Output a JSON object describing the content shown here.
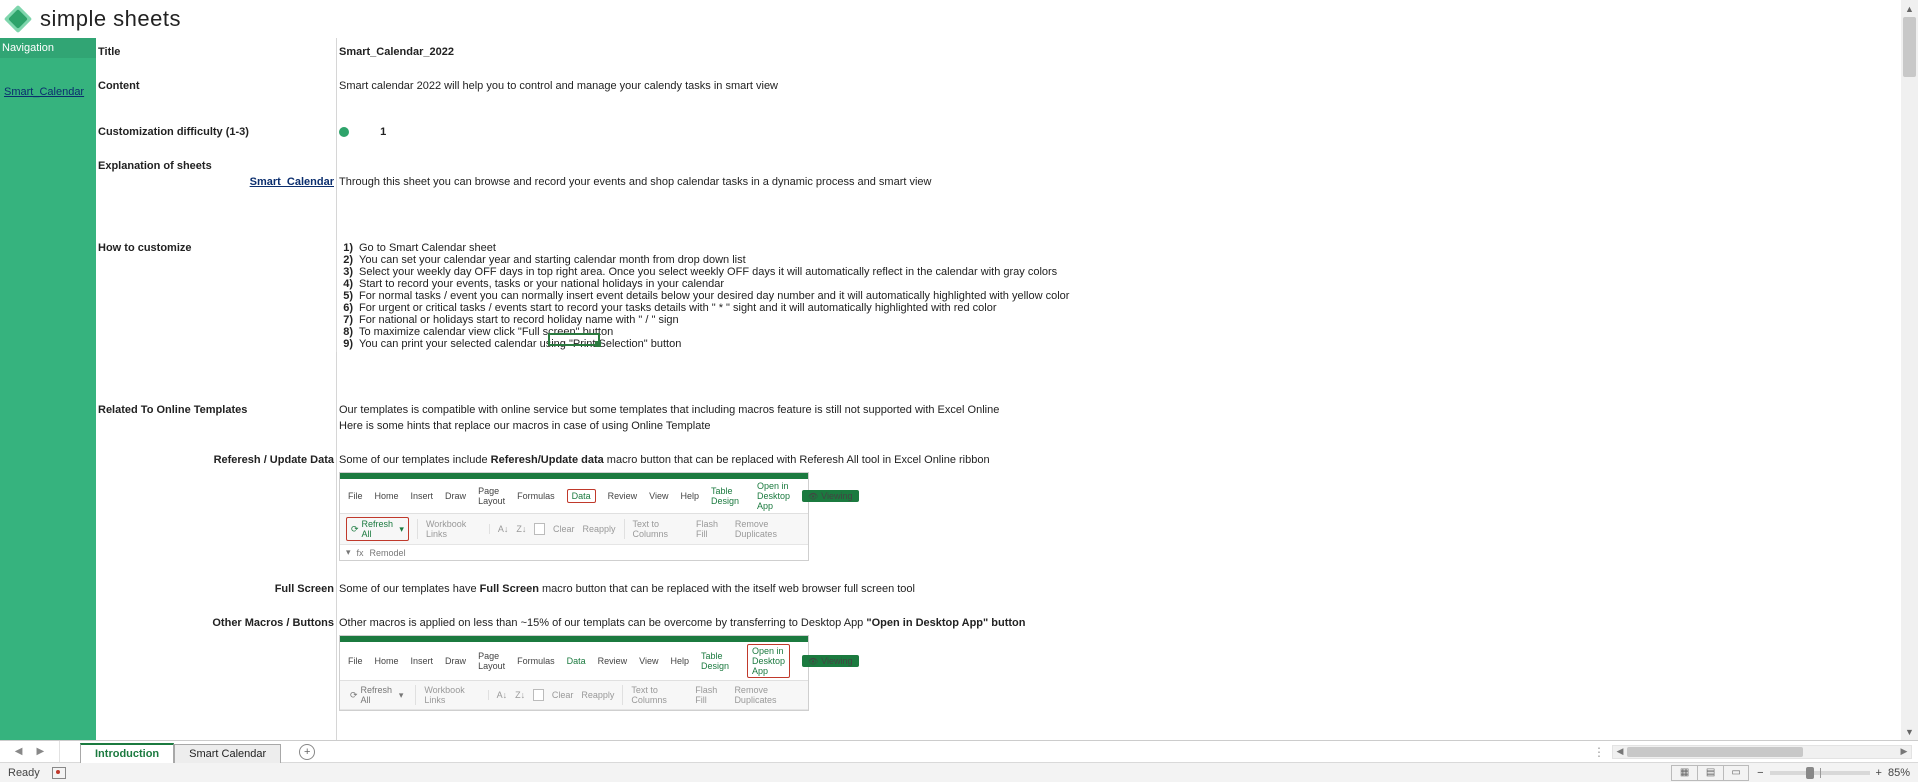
{
  "brand": {
    "name": "simple sheets"
  },
  "sidebar": {
    "nav_title": "Navigation",
    "link": "Smart_Calendar"
  },
  "labels": {
    "title": "Title",
    "content": "Content",
    "difficulty": "Customization difficulty (1-3)",
    "explanation": "Explanation of sheets",
    "howto": "How to customize",
    "related": "Related To Online Templates",
    "refresh": "Referesh / Update Data",
    "fullscreen": "Full Screen",
    "other": "Other Macros / Buttons"
  },
  "values": {
    "title": "Smart_Calendar_2022",
    "content": "Smart calendar 2022 will help you to control and manage your calendy tasks in smart view",
    "difficulty": "1",
    "explanation_link": "Smart_Calendar",
    "explanation_text": "Through this sheet you can browse and record your events and shop calendar tasks in a dynamic process and smart view",
    "related_text": "Our templates is compatible with online service but some templates that including macros feature is still not supported with Excel Online",
    "related_hint": "Here is some hints that replace our macros in case of using Online Template",
    "refresh_pre": "Some of our templates include ",
    "refresh_bold": "Referesh/Update data ",
    "refresh_post": "macro button that can be replaced with Referesh All tool in Excel Online ribbon",
    "fullscreen_pre": "Some of our templates have ",
    "fullscreen_bold": "Full Screen ",
    "fullscreen_post": "macro button that can be replaced with the itself web browser full screen tool",
    "other_pre": "Other macros is applied on less than ~15% of our templats can be overcome by transferring to Desktop App ",
    "other_bold": "\"Open in Desktop App\" button"
  },
  "steps": {
    "n1": "1)",
    "t1": "Go to Smart Calendar sheet",
    "n2": "2)",
    "t2": "You can set your calendar year and starting calendar month from drop down list",
    "n3": "3)",
    "t3": "Select your weekly day OFF days in top right area. Once you select weekly OFF days it will automatically reflect in the calendar with gray colors",
    "n4": "4)",
    "t4": "Start to record your events, tasks or your national holidays in your calendar",
    "n5": "5)",
    "t5": "For normal tasks / event you can normally insert event details below your desired day number and it will automatically highlighted with yellow color",
    "n6": "6)",
    "t6": "For urgent or critical tasks / events start to record your tasks details with \" * \" sight and it will automatically highlighted with red color",
    "n7": "7)",
    "t7": "For national or holidays start to record holiday name with \" / \" sign",
    "n8": "8)",
    "t8": "To maximize calendar view click \"Full screen\" button",
    "n9": "9)",
    "t9": "You can print your selected calendar using \"Print Selection\" button"
  },
  "ribbon": {
    "tabs": [
      "File",
      "Home",
      "Insert",
      "Draw",
      "Page Layout",
      "Formulas",
      "Data",
      "Review",
      "View",
      "Help",
      "Table Design",
      "Open in Desktop App"
    ],
    "viewing": "Viewing",
    "refresh_all": "Refresh All",
    "workbook_links": "Workbook Links",
    "clear": "Clear",
    "reapply": "Reapply",
    "ttc": "Text to Columns",
    "flash": "Flash Fill",
    "remove": "Remove Duplicates",
    "fx": "fx",
    "remodel": "Remodel"
  },
  "tabs": {
    "introduction": "Introduction",
    "smart_calendar": "Smart Calendar",
    "add": "+"
  },
  "statusbar": {
    "ready": "Ready",
    "zoom": "85%",
    "minus": "−",
    "plus": "+"
  },
  "hscroll": {
    "left": "◀",
    "right": "▶"
  },
  "vscroll": {
    "up": "▲",
    "down": "▼"
  }
}
